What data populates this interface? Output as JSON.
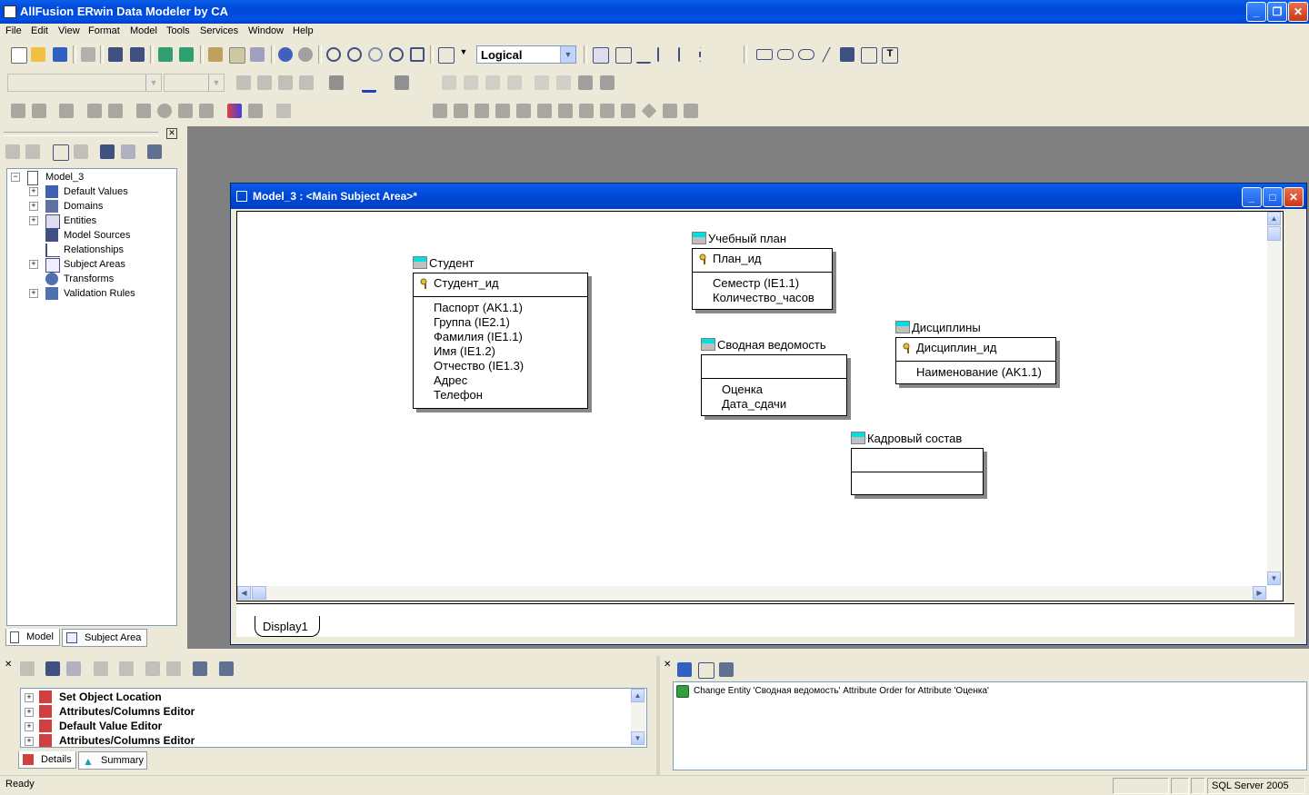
{
  "app": {
    "title": "AllFusion ERwin Data Modeler by CA"
  },
  "menu": [
    "File",
    "Edit",
    "View",
    "Format",
    "Model",
    "Tools",
    "Services",
    "Window",
    "Help"
  ],
  "toolbar": {
    "view_mode": "Logical"
  },
  "tree": {
    "root": "Model_3",
    "items": [
      "Default Values",
      "Domains",
      "Entities",
      "Model Sources",
      "Relationships",
      "Subject Areas",
      "Transforms",
      "Validation Rules"
    ]
  },
  "left_tabs": {
    "model": "Model",
    "subject_area": "Subject Area"
  },
  "model_window": {
    "title": "Model_3 : <Main Subject Area>*",
    "tab": "Display1"
  },
  "entities": [
    {
      "name": "Студент",
      "keys": [
        "Студент_ид"
      ],
      "attrs": [
        "Паспорт (AK1.1)",
        "Группа (IE2.1)",
        "Фамилия (IE1.1)",
        "Имя (IE1.2)",
        "Отчество (IE1.3)",
        "Адрес",
        "Телефон"
      ]
    },
    {
      "name": "Учебный план",
      "keys": [
        "План_ид"
      ],
      "attrs": [
        "Семестр (IE1.1)",
        "Количество_часов"
      ]
    },
    {
      "name": "Сводная ведомость",
      "keys": [],
      "attrs": [
        "Оценка",
        "Дата_сдачи"
      ]
    },
    {
      "name": "Дисциплины",
      "keys": [
        "Дисциплин_ид"
      ],
      "attrs": [
        "Наименование (AK1.1)"
      ]
    },
    {
      "name": "Кадровый состав",
      "keys": [],
      "attrs": []
    }
  ],
  "actions": {
    "items": [
      "Set Object Location",
      "Attributes/Columns Editor",
      "Default Value Editor",
      "Attributes/Columns Editor"
    ],
    "tabs": {
      "details": "Details",
      "summary": "Summary"
    }
  },
  "log": {
    "message": "Change Entity 'Сводная ведомость' Attribute Order for Attribute 'Оценка'"
  },
  "status": {
    "left": "Ready",
    "server": "SQL Server 2005"
  },
  "colors": {
    "titlebar": "#0054e3",
    "entity_icon": "#00e0e0"
  }
}
